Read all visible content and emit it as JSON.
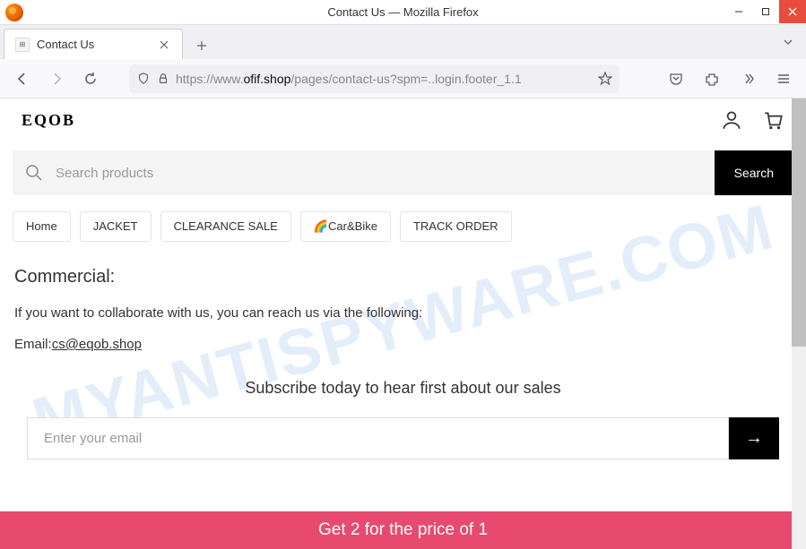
{
  "window": {
    "title": "Contact Us — Mozilla Firefox"
  },
  "tab": {
    "title": "Contact Us"
  },
  "url": {
    "prefix": "https://www.",
    "domain": "ofif.shop",
    "path": "/pages/contact-us?spm=..login.footer_1.1"
  },
  "shop": {
    "logo": "EQOB",
    "search": {
      "placeholder": "Search products",
      "button": "Search"
    },
    "nav": [
      {
        "label": "Home"
      },
      {
        "label": "JACKET"
      },
      {
        "label": "CLEARANCE SALE"
      },
      {
        "label": "🌈Car&Bike"
      },
      {
        "label": "TRACK ORDER"
      }
    ],
    "content": {
      "heading": "Commercial:",
      "body": "If you want to collaborate with us, you can reach us via the following:",
      "email_label": "Email:",
      "email_value": "cs@eqob.shop"
    },
    "subscribe": {
      "title": "Subscribe today to hear first about our sales",
      "placeholder": "Enter your email"
    },
    "promo": "Get 2 for the price of 1"
  },
  "watermark": "MYANTISPYWARE.COM"
}
